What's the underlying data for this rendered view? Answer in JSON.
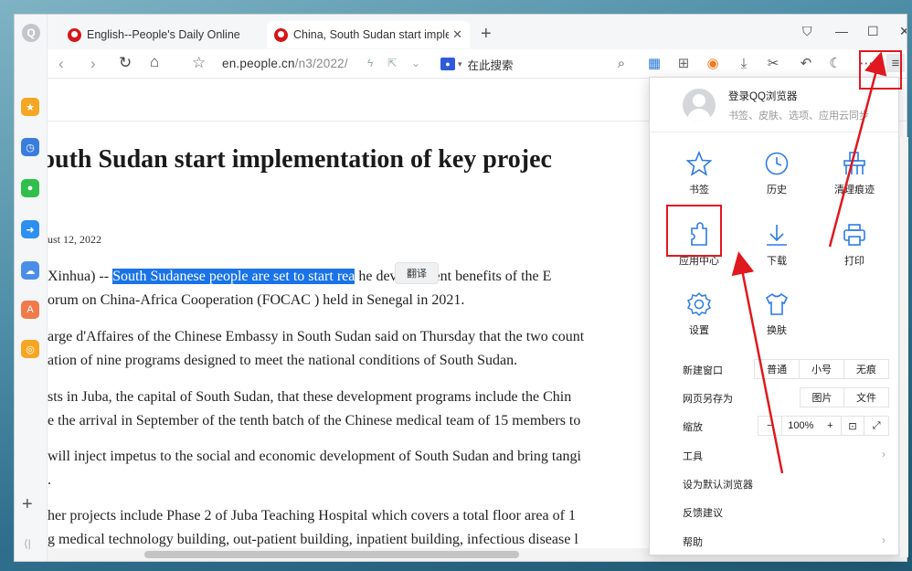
{
  "tabs": [
    {
      "title": "English--People's Daily Online",
      "active": false
    },
    {
      "title": "China, South Sudan start impleme",
      "active": true,
      "close": "✕"
    }
  ],
  "new_tab": "+",
  "window_controls": {
    "menu": "⛉",
    "minimize": "—",
    "maximize": "☐",
    "close": "✕"
  },
  "address": {
    "url_host": "en.people.cn",
    "url_path": "/n3/2022/",
    "search_placeholder": "在此搜索"
  },
  "sidebar": {
    "logo": "Q",
    "add": "+",
    "collapse": "⟨|"
  },
  "article": {
    "headline": "outh Sudan start implementation of key projec",
    "date": "ust 12, 2022",
    "p1a_pre": "Xinhua) -- ",
    "p1a_sel": "South Sudanese people are set to start rea",
    "p1a_post": "  he development benefits of the E",
    "p1b": "orum on China-Africa Cooperation (FOCAC ) held in Senegal in 2021.",
    "p2a": "arge d'Affaires of the Chinese Embassy in South Sudan said on Thursday that the two count",
    "p2b": "ation of nine programs designed to meet the national conditions of South Sudan.",
    "p3a": "sts in Juba, the capital of South Sudan, that these development programs include the Chin",
    "p3b": "e the arrival in September of the tenth batch of the Chinese medical team of 15 members to",
    "p4a": "will inject impetus to the social and economic development of South Sudan and bring tangi",
    "p4b": ".",
    "p5a": "her projects include Phase 2 of Juba Teaching Hospital which covers a total floor area of 1",
    "p5b": "g medical technology building, out-patient building, inpatient building, infectious disease l",
    "translate_popup": "翻译"
  },
  "menu": {
    "login_title": "登录QQ浏览器",
    "login_sub": "书签、皮肤、选项、应用云同步",
    "grid": [
      {
        "label": "书签",
        "icon": "star-icon"
      },
      {
        "label": "历史",
        "icon": "clock-icon"
      },
      {
        "label": "清理痕迹",
        "icon": "broom-icon"
      },
      {
        "label": "应用中心",
        "icon": "puzzle-icon"
      },
      {
        "label": "下载",
        "icon": "download-icon"
      },
      {
        "label": "打印",
        "icon": "printer-icon"
      },
      {
        "label": "设置",
        "icon": "gear-icon"
      },
      {
        "label": "换肤",
        "icon": "shirt-icon"
      }
    ],
    "new_window": {
      "label": "新建窗口",
      "options": [
        "普通",
        "小号",
        "无痕"
      ]
    },
    "save_as": {
      "label": "网页另存为",
      "options": [
        "图片",
        "文件"
      ]
    },
    "zoom": {
      "label": "缩放",
      "minus": "−",
      "value": "100%",
      "plus": "+"
    },
    "tools": "工具",
    "set_default": "设为默认浏览器",
    "feedback": "反馈建议",
    "help": "帮助"
  },
  "colors": {
    "annotation_red": "#e0181f",
    "selection_blue": "#1a73e8",
    "accent_blue": "#2d7be5"
  }
}
